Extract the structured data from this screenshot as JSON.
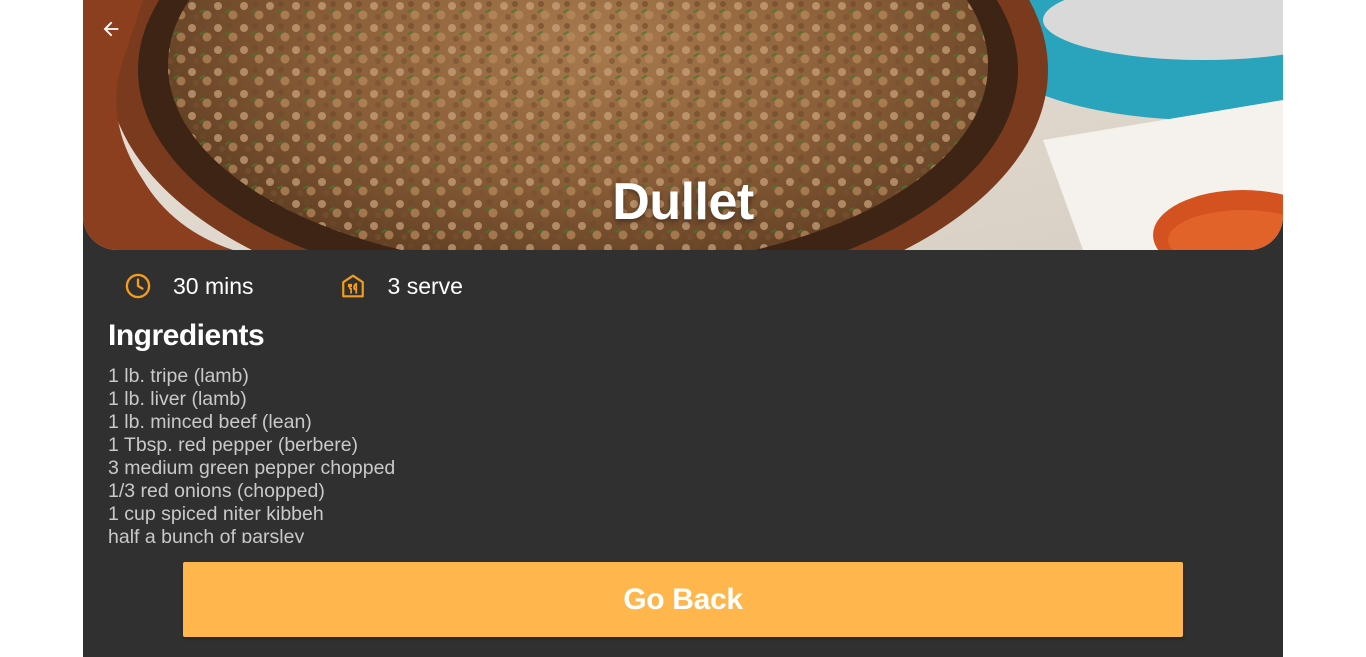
{
  "recipe": {
    "title": "Dullet",
    "time": "30 mins",
    "servings": "3 serve",
    "time_icon": "clock-icon",
    "servings_icon": "restaurant-icon"
  },
  "ingredients": {
    "heading": "Ingredients",
    "items": [
      "1 lb. tripe (lamb)",
      "1 lb. liver (lamb)",
      "1 lb. minced beef (lean)",
      "1 Tbsp. red pepper (berbere)",
      "3 medium green pepper chopped",
      "1/3 red onions (chopped)",
      "1 cup spiced niter kibbeh",
      "half a bunch of parsley"
    ]
  },
  "actions": {
    "go_back_label": "Go Back",
    "back_icon": "arrow-back-icon"
  },
  "colors": {
    "accent": "#ffb74d",
    "icon_accent": "#f59c1a",
    "background": "#303030",
    "text_primary": "#ffffff",
    "text_secondary": "#c9c9c9"
  }
}
